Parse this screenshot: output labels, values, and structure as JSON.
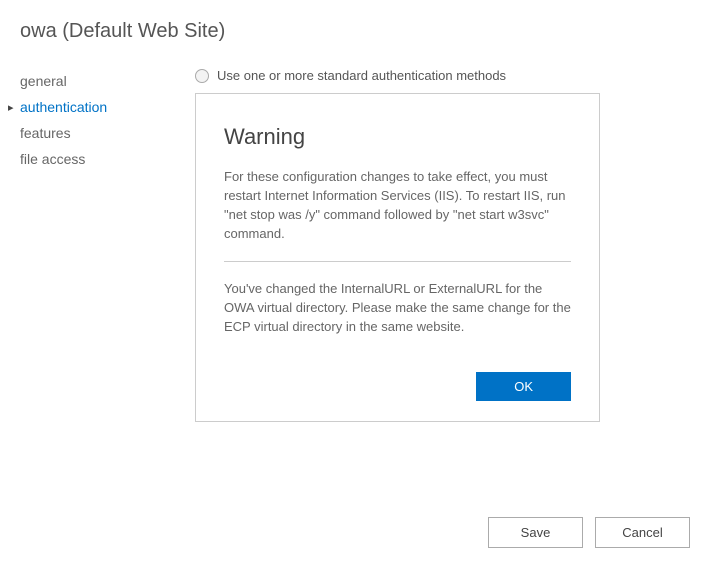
{
  "page_title": "owa (Default Web Site)",
  "sidebar": {
    "items": [
      {
        "label": "general"
      },
      {
        "label": "authentication"
      },
      {
        "label": "features"
      },
      {
        "label": "file access"
      }
    ],
    "active_index": 1
  },
  "auth_option": {
    "label": "Use one or more standard authentication methods"
  },
  "dialog": {
    "title": "Warning",
    "paragraph1": "For these configuration changes to take effect, you must restart Internet Information Services (IIS). To restart IIS, run \"net stop was /y\" command followed by \"net start w3svc\" command.",
    "paragraph2": "You've changed the InternalURL or ExternalURL for the OWA virtual directory. Please make the same change for the ECP virtual directory in the same website.",
    "ok_label": "OK"
  },
  "buttons": {
    "save": "Save",
    "cancel": "Cancel"
  }
}
